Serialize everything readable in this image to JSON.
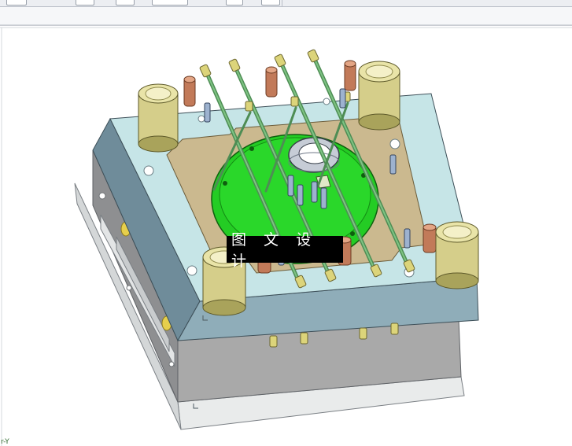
{
  "viewport": {
    "watermark": "图 文 设 计",
    "axis_label": "r-Y"
  },
  "toolbar": {
    "icons": [
      "tool-icon",
      "dropdown-icon",
      "dropdown-icon",
      "dropdown-icon",
      "dropdown-icon"
    ]
  },
  "colors": {
    "plate_top": "#c5e4e6",
    "plate_side_front": "#8eabb8",
    "plate_side_left": "#6d8b99",
    "lower_block": "#a6a6a6",
    "base_plate": "#e9ebeb",
    "insert_plate": "#c9b78d",
    "core_green": "#22cc22",
    "guide_bushing": "#d6cf8c",
    "cooling_line": "#59a05f",
    "fitting": "#dad37a"
  }
}
